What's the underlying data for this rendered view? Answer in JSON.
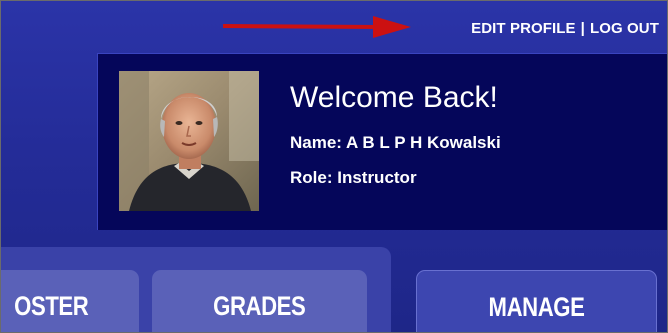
{
  "header": {
    "edit_profile_label": "EDIT PROFILE",
    "separator": "|",
    "logout_label": "LOG OUT",
    "arrow_color": "#cc1111"
  },
  "welcome": {
    "title": "Welcome Back!",
    "name_line": "Name: A B L P H Kowalski",
    "role_line": "Role: Instructor",
    "avatar": "user-photo"
  },
  "tabs": [
    {
      "label": "OSTER"
    },
    {
      "label": "GRADES"
    },
    {
      "label": "MANAGE"
    }
  ],
  "colors": {
    "background": "#242c98",
    "panel": "#05065a",
    "tab": "#5a61b8",
    "tab_active": "#3d46b0",
    "text": "#ffffff"
  }
}
